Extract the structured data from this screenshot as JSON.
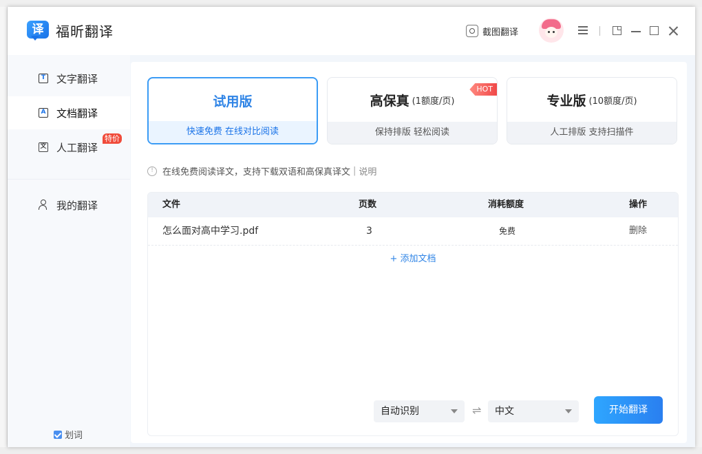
{
  "app": {
    "name": "福昕翻译",
    "logo_char": "译"
  },
  "header": {
    "screenshot_translate": "截图翻译"
  },
  "sidebar": {
    "items": [
      {
        "label": "文字翻译",
        "icon": "T"
      },
      {
        "label": "文档翻译",
        "icon": "A"
      },
      {
        "label": "人工翻译",
        "badge": "特价"
      },
      {
        "label": "我的翻译"
      }
    ],
    "word_pick": "划词"
  },
  "plans": [
    {
      "title": "试用版",
      "sub": "",
      "desc": "快速免费 在线对比阅读"
    },
    {
      "title": "高保真",
      "sub": "(1额度/页)",
      "desc": "保持排版 轻松阅读",
      "tag": "HOT"
    },
    {
      "title": "专业版",
      "sub": "(10额度/页)",
      "desc": "人工排版 支持扫描件"
    }
  ],
  "info": {
    "text": "在线免费阅读译文，支持下载双语和高保真译文",
    "sep": "|",
    "link": "说明"
  },
  "table": {
    "headers": {
      "file": "文件",
      "pages": "页数",
      "cost": "消耗额度",
      "action": "操作"
    },
    "rows": [
      {
        "file": "怎么面对高中学习.pdf",
        "pages": "3",
        "cost": "免费",
        "action": "删除"
      }
    ],
    "add": "+ 添加文档"
  },
  "lang": {
    "source": "自动识别",
    "target": "中文",
    "swap": "⇌"
  },
  "start_button": "开始翻译",
  "colors": {
    "accent": "#2f84e6",
    "hot": "#f04848",
    "special": "#f04b3a"
  }
}
